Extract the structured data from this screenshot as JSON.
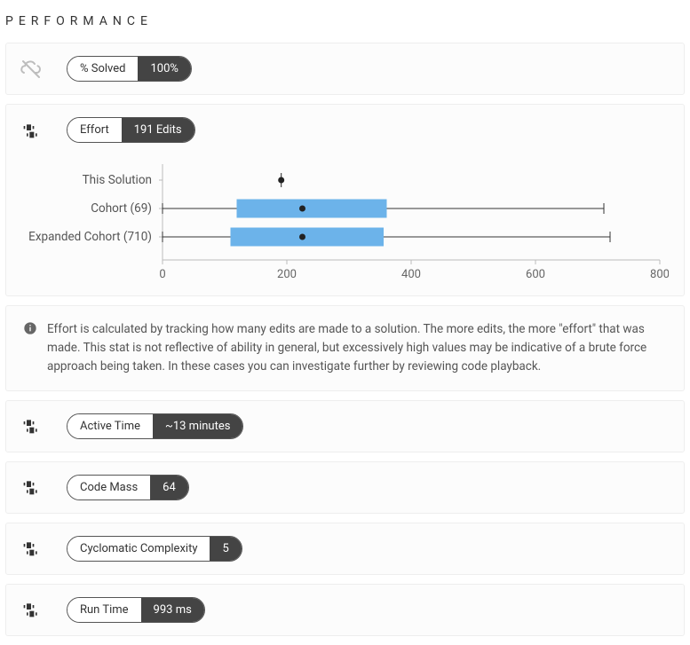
{
  "section_title": "PERFORMANCE",
  "metrics": {
    "solved": {
      "label": "% Solved",
      "value": "100%"
    },
    "effort": {
      "label": "Effort",
      "value": "191 Edits"
    },
    "active": {
      "label": "Active Time",
      "value": "~13 minutes"
    },
    "mass": {
      "label": "Code Mass",
      "value": "64"
    },
    "cyclo": {
      "label": "Cyclomatic Complexity",
      "value": "5"
    },
    "runtime": {
      "label": "Run Time",
      "value": "993 ms"
    }
  },
  "effort_note": "Effort is calculated by tracking how many edits are made to a solution. The more edits, the more \"effort\" that was made. This stat is not reflective of ability in general, but excessively high values may be indicative of a brute force approach being taken. In these cases you can investigate further by reviewing code playback.",
  "chart_data": {
    "type": "boxplot",
    "title": "",
    "xlabel": "",
    "ylabel": "",
    "xlim": [
      0,
      800
    ],
    "xticks": [
      0,
      200,
      400,
      600,
      800
    ],
    "series": [
      {
        "name": "This Solution",
        "point": 191
      },
      {
        "name": "Cohort (69)",
        "whisker_low": 0,
        "q1": 120,
        "median": 225,
        "q3": 360,
        "whisker_high": 710
      },
      {
        "name": "Expanded Cohort (710)",
        "whisker_low": 0,
        "q1": 110,
        "median": 225,
        "q3": 355,
        "whisker_high": 720
      }
    ]
  }
}
